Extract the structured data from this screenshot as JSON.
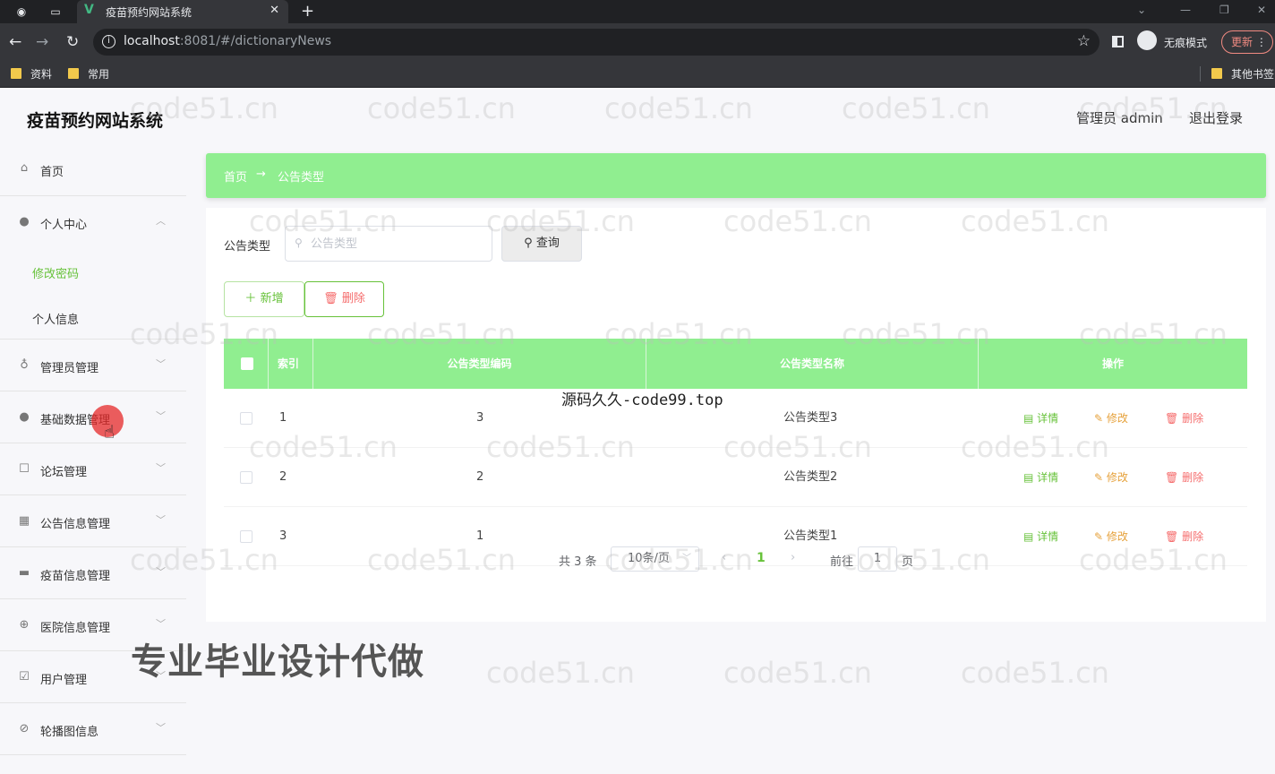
{
  "browser": {
    "tab_title": "疫苗预约网站系统",
    "url_host": "localhost",
    "url_rest": ":8081/#/dictionaryNews",
    "incognito_label": "无痕模式",
    "update_label": "更新",
    "bookmarks": [
      "资料",
      "常用"
    ],
    "other_bookmarks": "其他书签"
  },
  "header": {
    "title": "疫苗预约网站系统",
    "user": "管理员 admin",
    "logout": "退出登录"
  },
  "sidebar": {
    "home": "首页",
    "personal": "个人中心",
    "personal_sub": [
      "修改密码",
      "个人信息"
    ],
    "items": [
      "管理员管理",
      "基础数据管理",
      "论坛管理",
      "公告信息管理",
      "疫苗信息管理",
      "医院信息管理",
      "用户管理",
      "轮播图信息"
    ]
  },
  "breadcrumb": {
    "home": "首页",
    "arrow": "→",
    "current": "公告类型"
  },
  "search": {
    "label": "公告类型",
    "placeholder": "公告类型",
    "button": "查询"
  },
  "actions": {
    "add": "新增",
    "delete": "删除"
  },
  "table": {
    "columns": [
      "索引",
      "公告类型编码",
      "公告类型名称",
      "操作"
    ],
    "rows": [
      {
        "index": "1",
        "code": "3",
        "name": "公告类型3"
      },
      {
        "index": "2",
        "code": "2",
        "name": "公告类型2"
      },
      {
        "index": "3",
        "code": "1",
        "name": "公告类型1"
      }
    ],
    "row_actions": {
      "detail": "详情",
      "edit": "修改",
      "remove": "删除"
    }
  },
  "pagination": {
    "total": "共 3 条",
    "page_size": "10条/页",
    "current_page": "1",
    "goto": "前往",
    "goto_value": "1",
    "unit": "页"
  },
  "overlays": {
    "center_text": "源码久久-code99.top",
    "promo": "专业毕业设计代做",
    "watermark": "code51.cn"
  },
  "colors": {
    "accent_green": "#90ee90",
    "success": "#67c23a",
    "warning": "#e6a23c",
    "danger": "#f56c6c"
  }
}
